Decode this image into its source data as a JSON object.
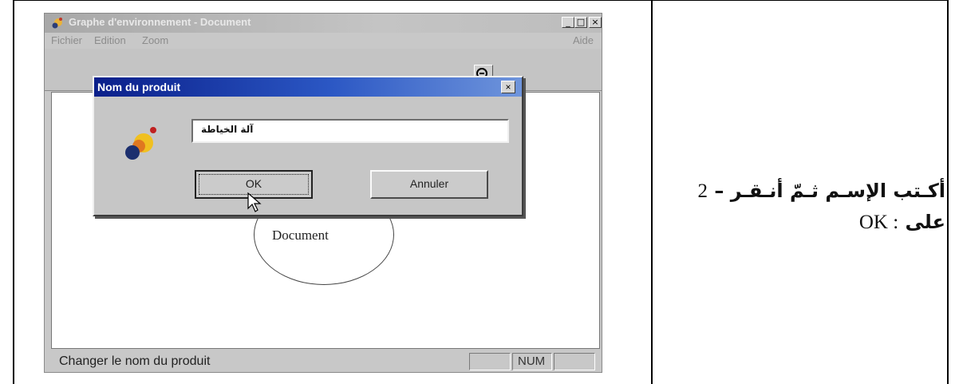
{
  "window": {
    "title": "Graphe d'environnement - Document",
    "controls": {
      "minimize": "_",
      "maximize": "□",
      "close": "×"
    },
    "menu": [
      "Fichier",
      "Edition",
      "Zoom"
    ],
    "menu_right": "Aide"
  },
  "dialog": {
    "title": "Nom du produit",
    "close": "×",
    "input_value": "آلة الخياطة",
    "ok_label": "OK",
    "cancel_label": "Annuler"
  },
  "canvas": {
    "ellipse_label": "Document"
  },
  "statusbar": {
    "text": "Changer le nom du produit",
    "num": "NUM"
  },
  "instruction": {
    "step": "2",
    "dash": "–",
    "text1": "أكـتب الإسـم ثـمّ أنـقـر",
    "text2": "على",
    "ok": "OK :"
  },
  "colors": {
    "dialog_title_bar": "#0a1f8a",
    "window_bg": "#c8c8c8"
  }
}
